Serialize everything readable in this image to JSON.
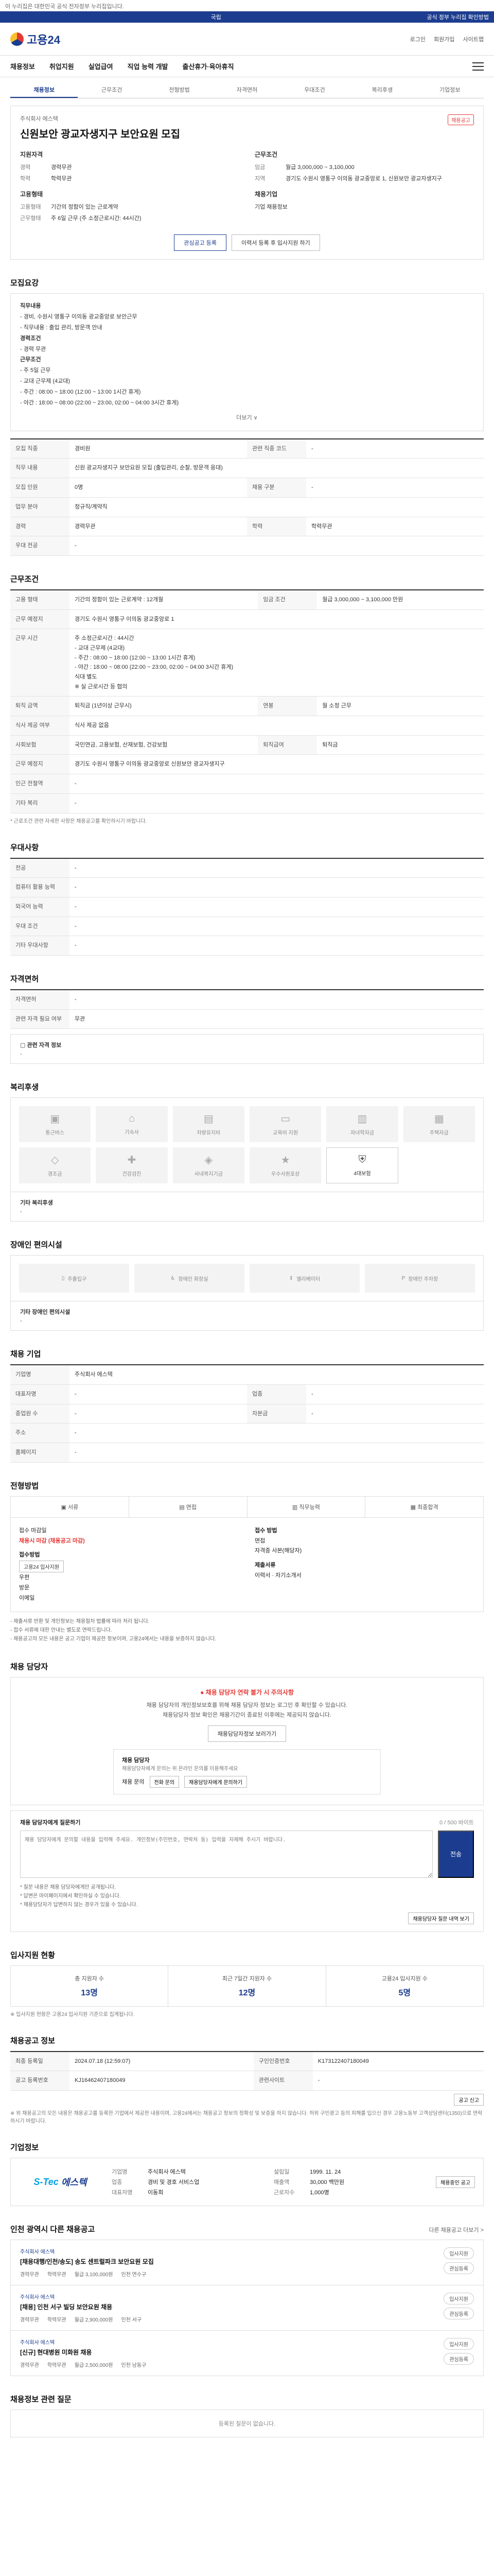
{
  "top_notice": "이 누리집은 대한민국 공식 전자정부 누리집입니다.",
  "gov_bar": {
    "center": "국립",
    "right": "공식 정부 누리집 확인방법"
  },
  "header": {
    "logo": "고용24",
    "links": [
      "로그인",
      "회원가입",
      "사이트맵"
    ]
  },
  "gnb": [
    "채용정보",
    "취업지원",
    "실업급여",
    "직업 능력 개발",
    "출산휴가·육아휴직"
  ],
  "subtabs": [
    "채용정보",
    "근무조건",
    "전형방법",
    "자격면허",
    "우대조건",
    "복리후생",
    "기업정보"
  ],
  "job": {
    "company_small": "주식회사 에스텍",
    "title": "신원보안 광교자생지구 보안요원 모집",
    "badge": "채용공고",
    "left_head": "지원자격",
    "left": [
      {
        "k": "경력",
        "v": "경력무관"
      },
      {
        "k": "학력",
        "v": "학력무관"
      }
    ],
    "left2_head": "고용형태",
    "left2": [
      {
        "k": "고용형태",
        "v": "기간의 정함이 있는 근로계약"
      },
      {
        "k": "근무형태",
        "v": "주 6일 근무 (주 소정근로시간: 44시간)"
      }
    ],
    "right_head": "근무조건",
    "right": [
      {
        "k": "임금",
        "v": "월급 3,000,000 ~ 3,100,000"
      },
      {
        "k": "지역",
        "v": "경기도 수원시 영통구 이의동 광교중앙로 1, 신원보안 광교자생지구"
      }
    ],
    "right2_head": "채용기업",
    "right2": [
      {
        "k": "",
        "v": "기업 채용정보"
      }
    ],
    "btn_save": "관심공고 등록",
    "btn_apply": "이력서 등록 후 입사지원 하기"
  },
  "sec_recruit": {
    "title": "모집요강",
    "lines": [
      "직무내용",
      "- 경비, 수원시 영통구 이의동 광교중앙로 보안근무",
      "- 직무내용 : 출입 관리, 방문객 안내",
      "경력조건",
      "- 경력 무관",
      "근무조건",
      "- 주 5일 근무",
      "- 교대 근무제 (4교대)",
      "- 주간 : 08:00 ~ 18:00 (12:00 ~ 13:00 1시간 휴게)",
      "- 야간 : 18:00 ~ 08:00 (22:00 ~ 23:00, 02:00 ~ 04:00 3시간 휴게)"
    ],
    "more": "더보기 ∨"
  },
  "table1": [
    {
      "k": "모집 직종",
      "v": "경비원",
      "k2": "관련 직종 코드",
      "v2": "-"
    },
    {
      "k": "직무 내용",
      "v": "신원 광교자생지구 보안요원 모집 (출입관리, 순찰, 방문객 응대)",
      "k2": "",
      "v2": ""
    },
    {
      "k": "모집 인원",
      "v": "0명",
      "k2": "채용 구분",
      "v2": "-"
    },
    {
      "k": "업무 분야",
      "v": "정규직/계약직",
      "k2": "",
      "v2": ""
    },
    {
      "k": "경력",
      "v": "경력무관",
      "k2": "학력",
      "v2": "학력무관"
    },
    {
      "k": "우대 전공",
      "v": "-",
      "k2": "",
      "v2": ""
    }
  ],
  "sec_cond": {
    "title": "근무조건",
    "rows": [
      {
        "k": "고용 형태",
        "v": "기간의 정함이 있는 근로계약 : 12개월",
        "k2": "임금 조건",
        "v2": "월급 3,000,000 ~ 3,100,000 만원"
      },
      {
        "k": "근무 예정지",
        "v": "경기도 수원시 영통구 이의동 광교중앙로 1",
        "k2": "",
        "v2": ""
      },
      {
        "k": "근무 시간",
        "v": "주 소정근로시간 : 44시간\n- 교대 근무제 (4교대)\n- 주간 : 08:00 ~ 18:00 (12:00 ~ 13:00 1시간 휴게)\n- 야간 : 18:00 ~ 08:00 (22:00 ~ 23:00, 02:00 ~ 04:00 3시간 휴게)\n식대 별도\n※ 실 근로시간 등 협의",
        "k2": "",
        "v2": ""
      },
      {
        "k": "퇴직 금액",
        "v": "퇴직금 (1년이상 근무시)",
        "k2": "연봉",
        "v2": "월 소정 근무"
      },
      {
        "k": "식사 제공 여부",
        "v": "식사 제공 없음",
        "k2": "",
        "v2": ""
      },
      {
        "k": "사회보험",
        "v": "국민연금, 고용보험, 산재보험, 건강보험",
        "k2": "퇴직급여",
        "v2": "퇴직금"
      },
      {
        "k": "근무 예정지",
        "v": "경기도 수원시 영통구 이의동 광교중앙로 신원보안 광교자생지구",
        "k2": "",
        "v2": ""
      },
      {
        "k": "인근 전철역",
        "v": "-",
        "k2": "",
        "v2": ""
      },
      {
        "k": "기타 복리",
        "v": "-",
        "k2": "",
        "v2": ""
      }
    ],
    "note": "* 근로조건 관련 자세한 사항은 채용공고를 확인하시기 바랍니다."
  },
  "sec_pref": {
    "title": "우대사항",
    "rows": [
      {
        "k": "전공",
        "v": "-"
      },
      {
        "k": "컴퓨터 활용 능력",
        "v": "-"
      },
      {
        "k": "외국어 능력",
        "v": "-"
      },
      {
        "k": "우대 조건",
        "v": "-"
      },
      {
        "k": "기타 우대사항",
        "v": "-"
      }
    ]
  },
  "sec_license": {
    "title": "자격면허",
    "rows": [
      {
        "k": "자격면허",
        "v": "-"
      },
      {
        "k": "관련 자격 필요 여부",
        "v": "무관"
      }
    ],
    "sub_label": "▢ 관련 자격 정보",
    "sub_value": "-"
  },
  "sec_facility": {
    "title": "복리후생",
    "items": [
      {
        "label": "통근버스",
        "glyph": "▣",
        "on": false
      },
      {
        "label": "기숙사",
        "glyph": "⌂",
        "on": false
      },
      {
        "label": "차량유지비",
        "glyph": "▤",
        "on": false
      },
      {
        "label": "교육비 지원",
        "glyph": "▭",
        "on": false
      },
      {
        "label": "자녀학자금",
        "glyph": "▥",
        "on": false
      },
      {
        "label": "주택자금",
        "glyph": "▦",
        "on": false
      },
      {
        "label": "경조금",
        "glyph": "◇",
        "on": false
      },
      {
        "label": "건강검진",
        "glyph": "✚",
        "on": false
      },
      {
        "label": "사내복지기금",
        "glyph": "◈",
        "on": false
      },
      {
        "label": "우수사원포상",
        "glyph": "★",
        "on": false
      },
      {
        "label": "4대보험",
        "glyph": "⛨",
        "on": true
      }
    ],
    "sub_label": "기타 복리후생",
    "sub_value": "-"
  },
  "sec_disabled": {
    "title": "장애인 편의시설",
    "items": [
      "주출입구",
      "장애인 화장실",
      "엘리베이터",
      "장애인 주차장"
    ],
    "sub_label": "기타 장애인 편의시설",
    "sub_value": "-"
  },
  "sec_company_small": {
    "title": "채용 기업",
    "rows": [
      {
        "k": "기업명",
        "v": "주식회사 에스텍",
        "k2": "",
        "v2": ""
      },
      {
        "k": "대표자명",
        "v": "-",
        "k2": "업종",
        "v2": "-"
      },
      {
        "k": "종업원 수",
        "v": "-",
        "k2": "자본금",
        "v2": "-"
      },
      {
        "k": "주소",
        "v": "-",
        "k2": "",
        "v2": ""
      },
      {
        "k": "홈페이지",
        "v": "-",
        "k2": "",
        "v2": ""
      }
    ]
  },
  "sec_process": {
    "title": "전형방법",
    "tabs": [
      "▣ 서류",
      "▤ 면접",
      "▥ 직무능력",
      "▦ 최종합격"
    ],
    "left": [
      "접수 마감일",
      "채용시 마감 (채용공고 마감)",
      "",
      "접수방법",
      "고용24 입사지원",
      "우편",
      "방문",
      "이메일"
    ],
    "right": [
      "접수 방법",
      "면접",
      "자격증 사본(해당자)",
      "제출서류",
      "이력서 · 자기소개서"
    ],
    "warnings": [
      "- 제출서류 반환 및 개인정보는 채용절차 법률에 따라 처리 됩니다.",
      "- 접수 서류에 대한 안내는 별도로 연락드립니다.",
      "- 채용공고의 모든 내용은 공고 기업이 제공한 정보이며, 고용24에서는 내용을 보증하지 않습니다."
    ]
  },
  "sec_contact": {
    "title": "채용 담당자",
    "alert": "● 채용 담당자 연락 불가 시 주의사항",
    "desc1": "채용 담당자의 개인정보보호를 위해 채용 담당자 정보는 로그인 후 확인할 수 있습니다.",
    "desc2": "채용담당자 정보 확인은 채용기간이 종료된 이후에는 제공되지 않습니다.",
    "btn": "채용담당자정보 보러가기",
    "inner_title": "채용 담당자",
    "inner_sub": "채용담당자에게 문의는 위 온라인 문의를 이용해주세요",
    "inner_k": "채용 문의",
    "inner_btn1": "전화 문의",
    "inner_btn2": "채용담당자에게 문의하기"
  },
  "sec_qna": {
    "head": "채용 담당자에게 질문하기",
    "counter": "0 / 500 바이트",
    "placeholder": "채용 담당자에게 문의할 내용을 입력해 주세요. 개인정보(주민번호, 연락처 등) 입력을 자제해 주시기 바랍니다.",
    "submit": "전송",
    "notes": [
      "* 질문 내용은 채용 담당자에게만 공개됩니다.",
      "* 답변은 마이페이지에서 확인하실 수 있습니다.",
      "* 채용담당자가 답변하지 않는 경우가 있을 수 있습니다."
    ],
    "link": "채용담당자 질문 내역 보기"
  },
  "sec_stats": {
    "title": "입사지원 현황",
    "items": [
      {
        "label": "총 지원자 수",
        "value": "13명"
      },
      {
        "label": "최근 7일간 지원자 수",
        "value": "12명"
      },
      {
        "label": "고용24 입사지원 수",
        "value": "5명"
      }
    ],
    "note": "※ 입사지원 현황은 고용24 입사지원 기준으로 집계됩니다."
  },
  "sec_notice_info": {
    "title": "채용공고 정보",
    "rows": [
      {
        "k": "최종 등록일",
        "v": "2024.07.18 (12:59:07)",
        "k2": "구인인증번호",
        "v2": "K173122407180049"
      },
      {
        "k": "공고 등록번호",
        "v": "KJ16462407180049",
        "k2": "관련사이트",
        "v2": "-"
      }
    ],
    "btn": "공고 신고",
    "note": "※ 위 채용공고의 모든 내용은 채용공고를 등록한 기업에서 제공한 내용이며, 고용24에서는 채용공고 정보의 정확성 및 보증을 하지 않습니다. 허위 구인광고 등의 피해를 입으신 경우 고용노동부 고객상담센터(1350)으로 연락하시기 바랍니다."
  },
  "sec_co": {
    "title": "기업정보",
    "logo_a": "S-Tec",
    "logo_b": "에스텍",
    "rows": [
      {
        "k": "기업명",
        "v": "주식회사 에스텍"
      },
      {
        "k": "설립일",
        "v": "1999. 11. 24"
      },
      {
        "k": "업종",
        "v": "경비 및 경호 서비스업"
      },
      {
        "k": "매출액",
        "v": "30,000 백만원"
      },
      {
        "k": "대표자명",
        "v": "이동희"
      },
      {
        "k": "근로자수",
        "v": "1,000명"
      }
    ],
    "btn": "채용중인 공고"
  },
  "sec_others": {
    "title": "인천 광역시 다른 채용공고",
    "more": "다른 채용공고 더보기 >",
    "items": [
      {
        "co": "주식회사 에스텍",
        "title": "[채용대행/인천/송도] 송도 센트럴파크 보안요원 모집",
        "meta": [
          "경력무관",
          "학력무관",
          "월급 3,100,000원",
          "인천 연수구"
        ],
        "btns": [
          "입사지원",
          "관심등록"
        ]
      },
      {
        "co": "주식회사 에스텍",
        "title": "[채용] 인천 서구 빌딩 보안요원 채용",
        "meta": [
          "경력무관",
          "학력무관",
          "월급 2,900,000원",
          "인천 서구"
        ],
        "btns": [
          "입사지원",
          "관심등록"
        ]
      },
      {
        "co": "주식회사 에스텍",
        "title": "[신규] 현대병원 미화원 채용",
        "meta": [
          "경력무관",
          "학력무관",
          "월급 2,500,000원",
          "인천 남동구"
        ],
        "btns": [
          "입사지원",
          "관심등록"
        ]
      }
    ]
  },
  "sec_faq": {
    "title": "채용정보 관련 질문",
    "empty": "등록된 질문이 없습니다."
  }
}
